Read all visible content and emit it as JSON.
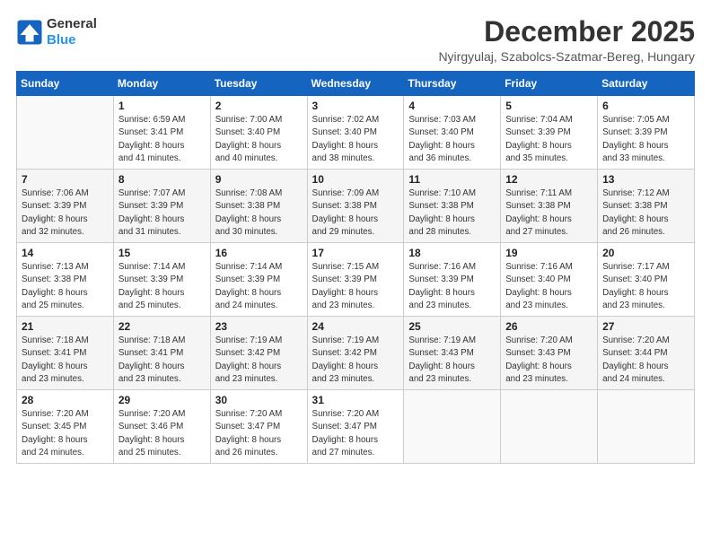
{
  "header": {
    "logo_line1": "General",
    "logo_line2": "Blue",
    "month": "December 2025",
    "location": "Nyirgyulaj, Szabolcs-Szatmar-Bereg, Hungary"
  },
  "weekdays": [
    "Sunday",
    "Monday",
    "Tuesday",
    "Wednesday",
    "Thursday",
    "Friday",
    "Saturday"
  ],
  "weeks": [
    [
      {
        "day": "",
        "sunrise": "",
        "sunset": "",
        "daylight": ""
      },
      {
        "day": "1",
        "sunrise": "Sunrise: 6:59 AM",
        "sunset": "Sunset: 3:41 PM",
        "daylight": "Daylight: 8 hours and 41 minutes."
      },
      {
        "day": "2",
        "sunrise": "Sunrise: 7:00 AM",
        "sunset": "Sunset: 3:40 PM",
        "daylight": "Daylight: 8 hours and 40 minutes."
      },
      {
        "day": "3",
        "sunrise": "Sunrise: 7:02 AM",
        "sunset": "Sunset: 3:40 PM",
        "daylight": "Daylight: 8 hours and 38 minutes."
      },
      {
        "day": "4",
        "sunrise": "Sunrise: 7:03 AM",
        "sunset": "Sunset: 3:40 PM",
        "daylight": "Daylight: 8 hours and 36 minutes."
      },
      {
        "day": "5",
        "sunrise": "Sunrise: 7:04 AM",
        "sunset": "Sunset: 3:39 PM",
        "daylight": "Daylight: 8 hours and 35 minutes."
      },
      {
        "day": "6",
        "sunrise": "Sunrise: 7:05 AM",
        "sunset": "Sunset: 3:39 PM",
        "daylight": "Daylight: 8 hours and 33 minutes."
      }
    ],
    [
      {
        "day": "7",
        "sunrise": "Sunrise: 7:06 AM",
        "sunset": "Sunset: 3:39 PM",
        "daylight": "Daylight: 8 hours and 32 minutes."
      },
      {
        "day": "8",
        "sunrise": "Sunrise: 7:07 AM",
        "sunset": "Sunset: 3:39 PM",
        "daylight": "Daylight: 8 hours and 31 minutes."
      },
      {
        "day": "9",
        "sunrise": "Sunrise: 7:08 AM",
        "sunset": "Sunset: 3:38 PM",
        "daylight": "Daylight: 8 hours and 30 minutes."
      },
      {
        "day": "10",
        "sunrise": "Sunrise: 7:09 AM",
        "sunset": "Sunset: 3:38 PM",
        "daylight": "Daylight: 8 hours and 29 minutes."
      },
      {
        "day": "11",
        "sunrise": "Sunrise: 7:10 AM",
        "sunset": "Sunset: 3:38 PM",
        "daylight": "Daylight: 8 hours and 28 minutes."
      },
      {
        "day": "12",
        "sunrise": "Sunrise: 7:11 AM",
        "sunset": "Sunset: 3:38 PM",
        "daylight": "Daylight: 8 hours and 27 minutes."
      },
      {
        "day": "13",
        "sunrise": "Sunrise: 7:12 AM",
        "sunset": "Sunset: 3:38 PM",
        "daylight": "Daylight: 8 hours and 26 minutes."
      }
    ],
    [
      {
        "day": "14",
        "sunrise": "Sunrise: 7:13 AM",
        "sunset": "Sunset: 3:38 PM",
        "daylight": "Daylight: 8 hours and 25 minutes."
      },
      {
        "day": "15",
        "sunrise": "Sunrise: 7:14 AM",
        "sunset": "Sunset: 3:39 PM",
        "daylight": "Daylight: 8 hours and 25 minutes."
      },
      {
        "day": "16",
        "sunrise": "Sunrise: 7:14 AM",
        "sunset": "Sunset: 3:39 PM",
        "daylight": "Daylight: 8 hours and 24 minutes."
      },
      {
        "day": "17",
        "sunrise": "Sunrise: 7:15 AM",
        "sunset": "Sunset: 3:39 PM",
        "daylight": "Daylight: 8 hours and 23 minutes."
      },
      {
        "day": "18",
        "sunrise": "Sunrise: 7:16 AM",
        "sunset": "Sunset: 3:39 PM",
        "daylight": "Daylight: 8 hours and 23 minutes."
      },
      {
        "day": "19",
        "sunrise": "Sunrise: 7:16 AM",
        "sunset": "Sunset: 3:40 PM",
        "daylight": "Daylight: 8 hours and 23 minutes."
      },
      {
        "day": "20",
        "sunrise": "Sunrise: 7:17 AM",
        "sunset": "Sunset: 3:40 PM",
        "daylight": "Daylight: 8 hours and 23 minutes."
      }
    ],
    [
      {
        "day": "21",
        "sunrise": "Sunrise: 7:18 AM",
        "sunset": "Sunset: 3:41 PM",
        "daylight": "Daylight: 8 hours and 23 minutes."
      },
      {
        "day": "22",
        "sunrise": "Sunrise: 7:18 AM",
        "sunset": "Sunset: 3:41 PM",
        "daylight": "Daylight: 8 hours and 23 minutes."
      },
      {
        "day": "23",
        "sunrise": "Sunrise: 7:19 AM",
        "sunset": "Sunset: 3:42 PM",
        "daylight": "Daylight: 8 hours and 23 minutes."
      },
      {
        "day": "24",
        "sunrise": "Sunrise: 7:19 AM",
        "sunset": "Sunset: 3:42 PM",
        "daylight": "Daylight: 8 hours and 23 minutes."
      },
      {
        "day": "25",
        "sunrise": "Sunrise: 7:19 AM",
        "sunset": "Sunset: 3:43 PM",
        "daylight": "Daylight: 8 hours and 23 minutes."
      },
      {
        "day": "26",
        "sunrise": "Sunrise: 7:20 AM",
        "sunset": "Sunset: 3:43 PM",
        "daylight": "Daylight: 8 hours and 23 minutes."
      },
      {
        "day": "27",
        "sunrise": "Sunrise: 7:20 AM",
        "sunset": "Sunset: 3:44 PM",
        "daylight": "Daylight: 8 hours and 24 minutes."
      }
    ],
    [
      {
        "day": "28",
        "sunrise": "Sunrise: 7:20 AM",
        "sunset": "Sunset: 3:45 PM",
        "daylight": "Daylight: 8 hours and 24 minutes."
      },
      {
        "day": "29",
        "sunrise": "Sunrise: 7:20 AM",
        "sunset": "Sunset: 3:46 PM",
        "daylight": "Daylight: 8 hours and 25 minutes."
      },
      {
        "day": "30",
        "sunrise": "Sunrise: 7:20 AM",
        "sunset": "Sunset: 3:47 PM",
        "daylight": "Daylight: 8 hours and 26 minutes."
      },
      {
        "day": "31",
        "sunrise": "Sunrise: 7:20 AM",
        "sunset": "Sunset: 3:47 PM",
        "daylight": "Daylight: 8 hours and 27 minutes."
      },
      {
        "day": "",
        "sunrise": "",
        "sunset": "",
        "daylight": ""
      },
      {
        "day": "",
        "sunrise": "",
        "sunset": "",
        "daylight": ""
      },
      {
        "day": "",
        "sunrise": "",
        "sunset": "",
        "daylight": ""
      }
    ]
  ]
}
